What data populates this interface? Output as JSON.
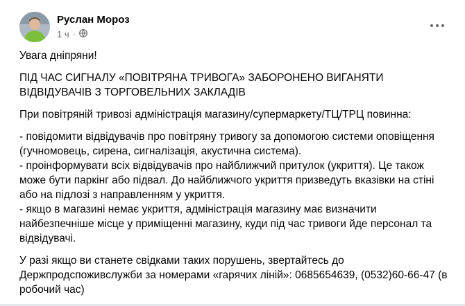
{
  "post": {
    "author": "Руслан Мороз",
    "time": "1 ч",
    "separator": "·",
    "paragraphs": [
      "Увага дніпряни!",
      "ПІД ЧАС СИГНАЛУ «ПОВІТРЯНА ТРИВОГА» ЗАБОРОНЕНО ВИГАНЯТИ ВІДВІДУВАЧІВ З ТОРГОВЕЛЬНИХ ЗАКЛАДІВ",
      "При повітряній тривозі адміністрація магазину/супермаркету/ТЦ/ТРЦ повинна:",
      "- повідомити відвідувачів про повітряну тривогу за допомогою системи оповіщення (гучномовець, сирена, сигналізація, акустична система).",
      "- проінформувати всіх відвідувачів про найближчий притулок (укриття). Це також може бути паркінг або підвал. До найближчого укриття призведуть вказівки на стіні або на підлозі з направленням у укриття.",
      "- якщо в магазині немає укриття, адміністрація магазину має визначити найбезпечніше місце у приміщенні магазину, куди під час тривоги йде персонал та відвідувачі.",
      "У разі якщо ви станете свідками таких порушень, звертайтесь до Держпродспоживслужби за номерами «гарячих ліній»: 0685654639, (0532)60-66-47 (в робочий час)"
    ]
  },
  "icons": {
    "privacy": "globe-icon",
    "more": "more-options-icon"
  }
}
